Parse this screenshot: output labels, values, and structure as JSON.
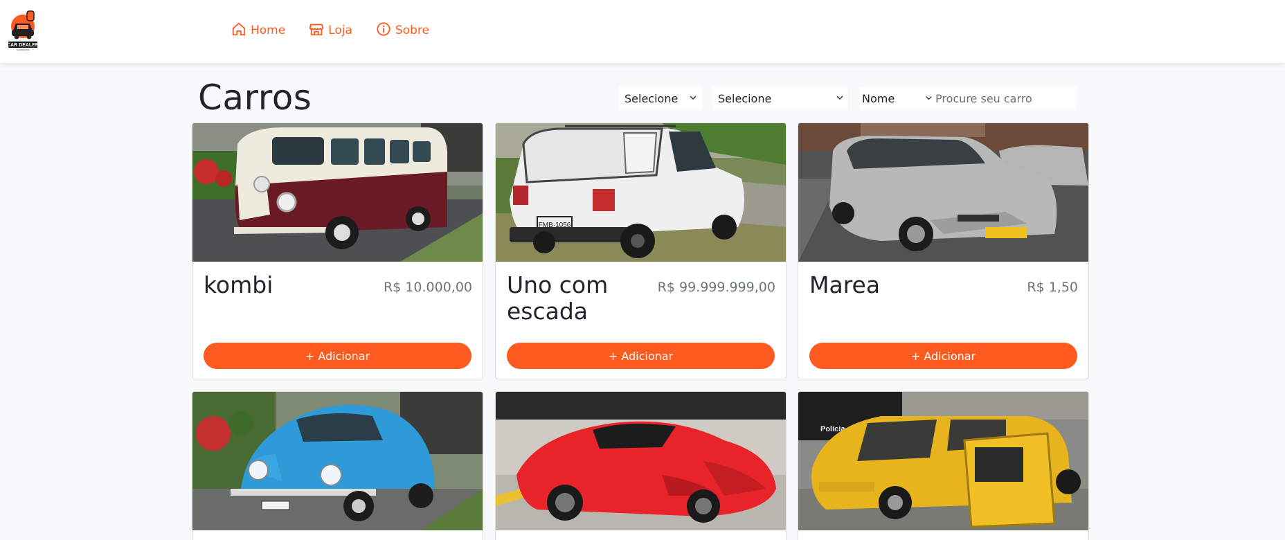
{
  "brand": {
    "logo_text": "CAR DEALER",
    "logo_sub": "SHOWROOM"
  },
  "nav": [
    {
      "label": "Home",
      "icon": "home-icon"
    },
    {
      "label": "Loja",
      "icon": "store-icon"
    },
    {
      "label": "Sobre",
      "icon": "info-icon"
    }
  ],
  "page": {
    "title": "Carros"
  },
  "filters": {
    "filter1": "Selecione",
    "filter2": "Selecione",
    "search_by": "Nome",
    "search_placeholder": "Procure seu carro"
  },
  "colors": {
    "accent": "#ff5a1f",
    "price": "#6c757d",
    "background": "#f8f9fa"
  },
  "cars": [
    {
      "name": "kombi",
      "price": "R$ 10.000,00",
      "button": "+ Adicionar"
    },
    {
      "name": "Uno com escada",
      "price": "R$ 99.999.999,00",
      "button": "+ Adicionar"
    },
    {
      "name": "Marea",
      "price": "R$ 1,50",
      "button": "+ Adicionar"
    },
    {
      "name": "",
      "price": "",
      "button": ""
    },
    {
      "name": "",
      "price": "",
      "button": ""
    },
    {
      "name": "",
      "price": "",
      "button": ""
    }
  ],
  "photo_labels": {
    "police": "Polícia"
  }
}
